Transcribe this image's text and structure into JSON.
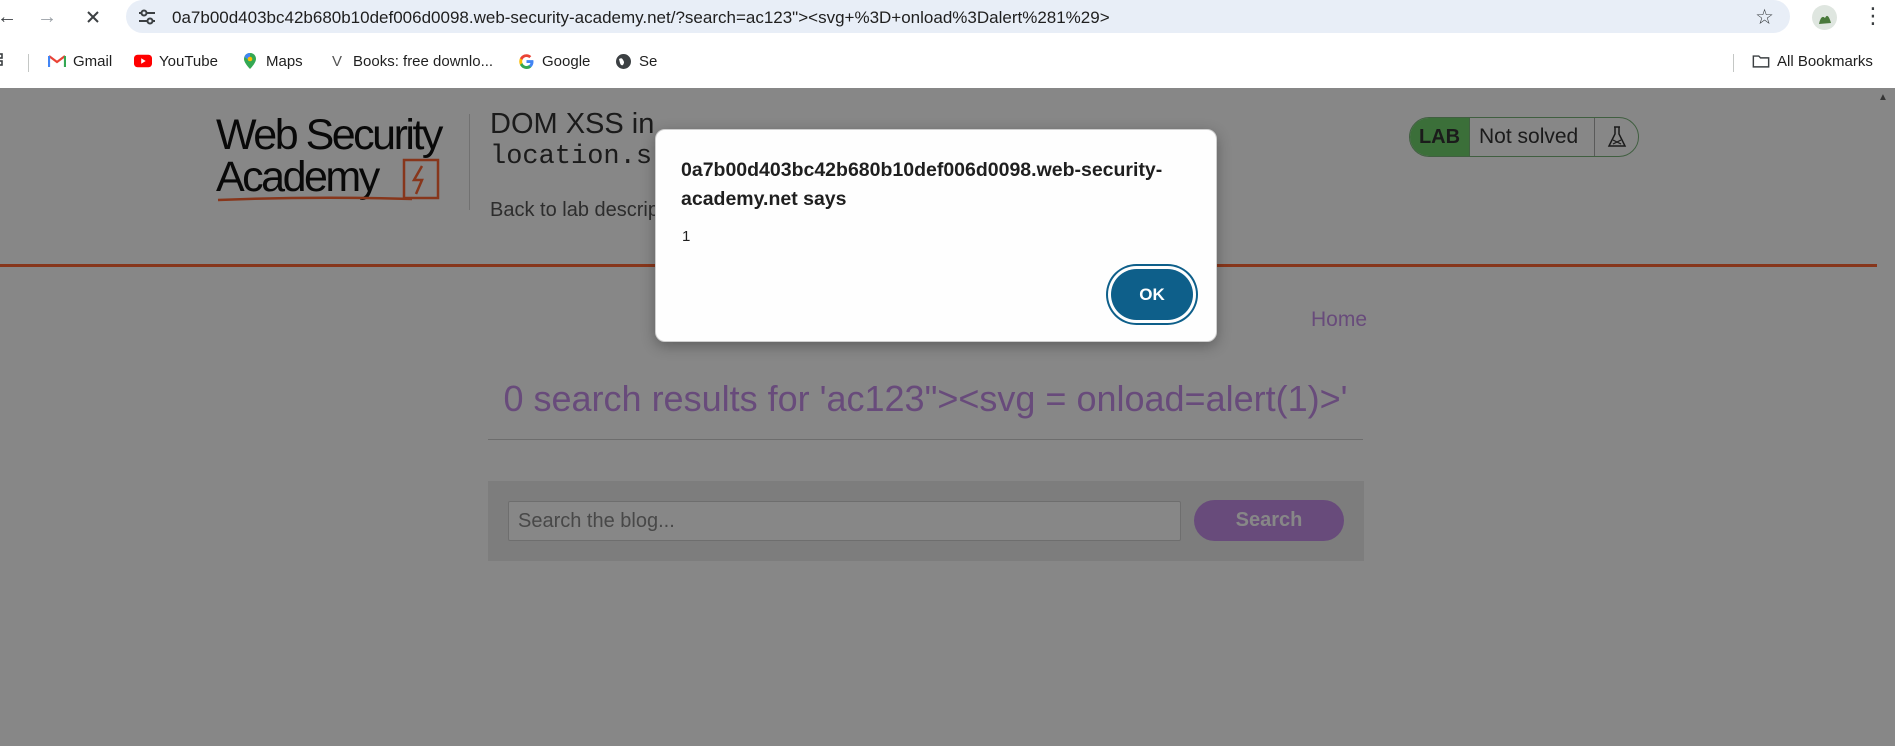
{
  "browser": {
    "url": "0a7b00d403bc42b680b10def006d0098.web-security-academy.net/?search=ac123\"><svg+%3D+onload%3Dalert%281%29>",
    "bookmarks": [
      {
        "label": "Gmail",
        "icon": "gmail-icon"
      },
      {
        "label": "YouTube",
        "icon": "youtube-icon"
      },
      {
        "label": "Maps",
        "icon": "maps-icon"
      },
      {
        "label": "Books: free downlo...",
        "icon": "books-icon"
      },
      {
        "label": "Google",
        "icon": "google-icon"
      },
      {
        "label": "Se",
        "icon": "globe-icon"
      }
    ],
    "all_bookmarks_label": "All Bookmarks"
  },
  "header": {
    "logo_line1": "Web Security",
    "logo_line2": "Academy",
    "lab_title": "DOM XSS in",
    "lab_code": "location.s",
    "back_link": "Back to lab descrip",
    "lab_tag": "LAB",
    "lab_status": "Not solved"
  },
  "main": {
    "home_link": "Home",
    "results_heading": "0 search results for 'ac123\"><svg = onload=alert(1)>'",
    "search_placeholder": "Search the blog...",
    "search_button": "Search"
  },
  "dialog": {
    "origin": "0a7b00d403bc42b680b10def006d0098.web-security-academy.net says",
    "message": "1",
    "ok_label": "OK"
  },
  "colors": {
    "accent_purple": "#c48ee8",
    "rule_orange": "#ff6633",
    "lab_green": "#70d16d",
    "ok_button": "#0e5f8a"
  }
}
